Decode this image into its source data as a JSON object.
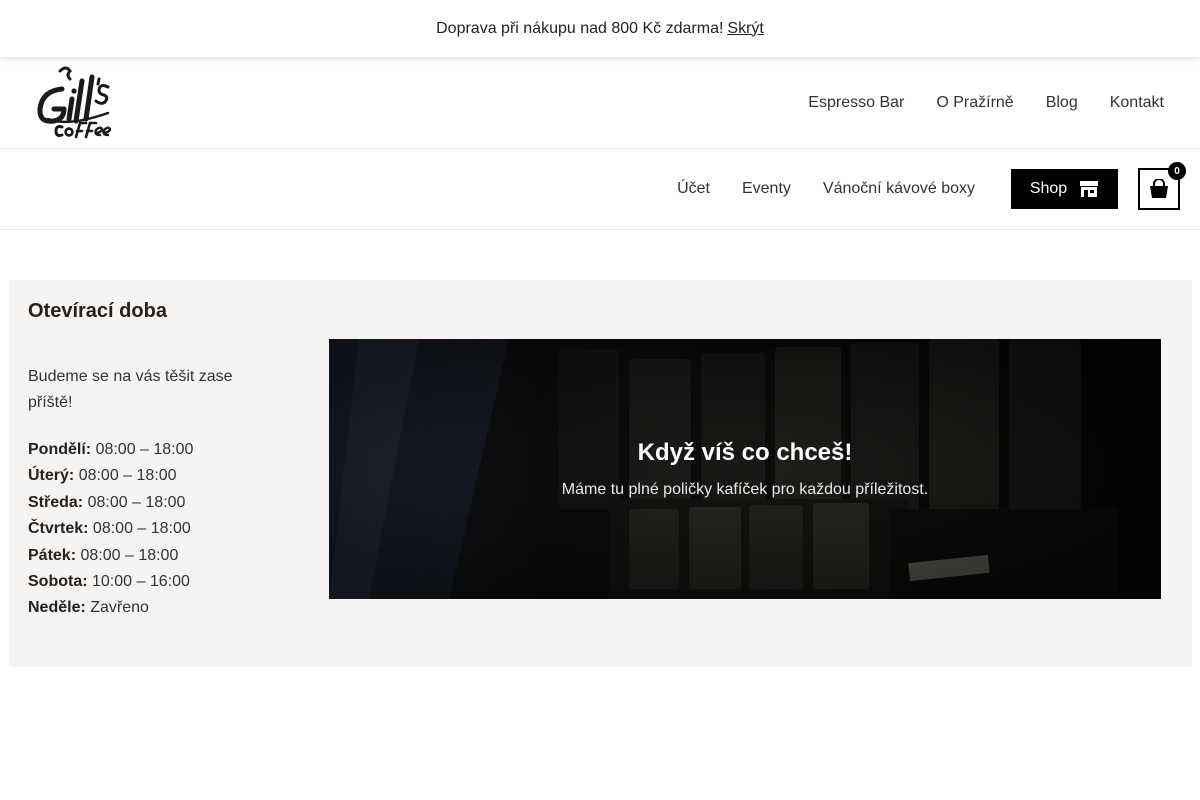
{
  "notice": {
    "message": "Doprava při nákupu nad 800 Kč zdarma!",
    "dismiss_label": "Skrýt"
  },
  "logo": {
    "brand_text": "Gill's Coffee",
    "icon": "gills-coffee-logo"
  },
  "primary_nav": {
    "items": [
      {
        "label": "Espresso Bar"
      },
      {
        "label": "O Pražírně"
      },
      {
        "label": "Blog"
      },
      {
        "label": "Kontakt"
      }
    ]
  },
  "secondary_nav": {
    "items": [
      {
        "label": "Účet"
      },
      {
        "label": "Eventy"
      },
      {
        "label": "Vánoční kávové boxy"
      }
    ]
  },
  "shop_button": {
    "label": "Shop",
    "icon": "storefront-icon"
  },
  "cart": {
    "icon": "shopping-bag-icon",
    "count": "0"
  },
  "hours": {
    "title": "Otevírací doba",
    "intro": "Budeme se na vás těšit zase příště!",
    "days": [
      {
        "day": "Pondělí:",
        "time": "08:00 – 18:00"
      },
      {
        "day": "Úterý:",
        "time": "08:00 – 18:00"
      },
      {
        "day": "Středa:",
        "time": "08:00 – 18:00"
      },
      {
        "day": "Čtvrtek:",
        "time": "08:00 – 18:00"
      },
      {
        "day": "Pátek:",
        "time": "08:00 – 18:00"
      },
      {
        "day": "Sobota:",
        "time": "10:00 – 16:00"
      },
      {
        "day": "Neděle:",
        "time": "Zavřeno"
      }
    ]
  },
  "promo": {
    "heading": "Když víš co chceš!",
    "subheading": "Máme tu plné poličky kafíček pro každou příležitost."
  },
  "colors": {
    "accent": "#000000",
    "section_bg": "#f5f4f2",
    "heading": "#2a2018"
  }
}
